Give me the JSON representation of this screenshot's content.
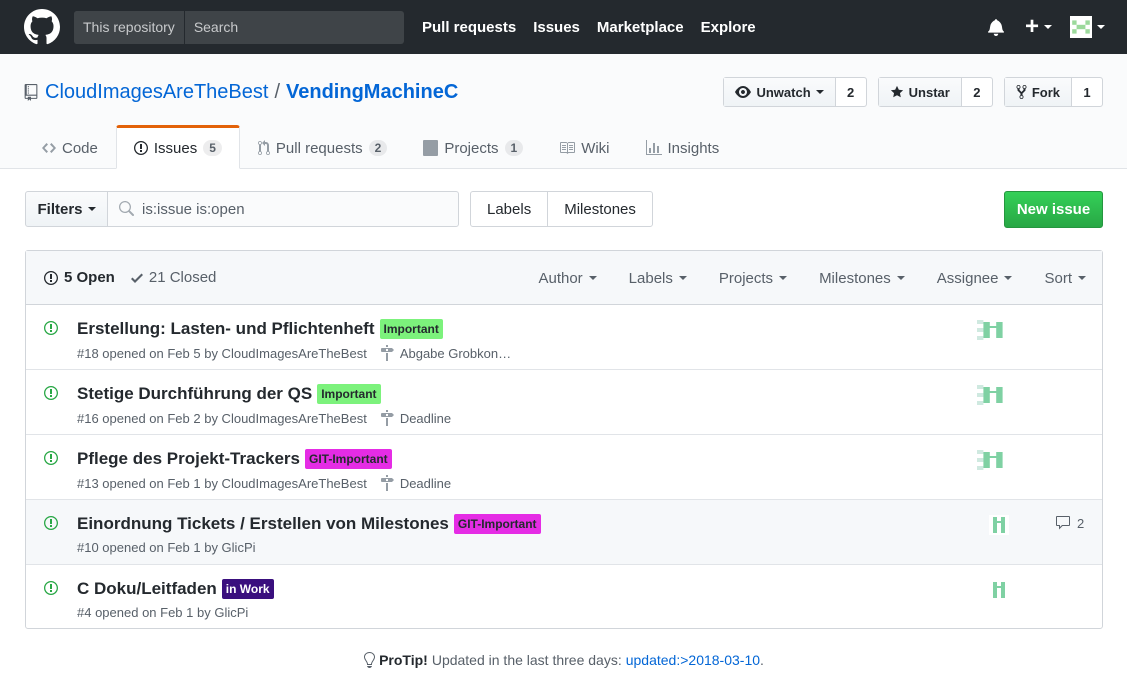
{
  "header": {
    "search_scope": "This repository",
    "search_placeholder": "Search",
    "nav": [
      "Pull requests",
      "Issues",
      "Marketplace",
      "Explore"
    ]
  },
  "repo": {
    "owner": "CloudImagesAreTheBest",
    "separator": "/",
    "name": "VendingMachineC",
    "unwatch_label": "Unwatch",
    "watch_count": "2",
    "unstar_label": "Unstar",
    "star_count": "2",
    "fork_label": "Fork",
    "fork_count": "1"
  },
  "tabs": [
    {
      "label": "Code",
      "count": ""
    },
    {
      "label": "Issues",
      "count": "5"
    },
    {
      "label": "Pull requests",
      "count": "2"
    },
    {
      "label": "Projects",
      "count": "1"
    },
    {
      "label": "Wiki",
      "count": ""
    },
    {
      "label": "Insights",
      "count": ""
    }
  ],
  "filterbar": {
    "filters_label": "Filters",
    "query": "is:issue is:open",
    "labels_label": "Labels",
    "milestones_label": "Milestones",
    "new_issue_label": "New issue"
  },
  "issues_header": {
    "open_label": "5 Open",
    "closed_label": "21 Closed",
    "menus": [
      "Author",
      "Labels",
      "Projects",
      "Milestones",
      "Assignee",
      "Sort"
    ]
  },
  "issues": [
    {
      "title": "Erstellung: Lasten- und Pflichtenheft",
      "label": "Important",
      "label_bg": "#7cf27c",
      "label_fg": "#24292e",
      "meta": "#18 opened on Feb 5 by CloudImagesAreTheBest",
      "milestone": "Abgabe Grobkon…",
      "comments": ""
    },
    {
      "title": "Stetige Durchführung der QS",
      "label": "Important",
      "label_bg": "#7cf27c",
      "label_fg": "#24292e",
      "meta": "#16 opened on Feb 2 by CloudImagesAreTheBest",
      "milestone": "Deadline",
      "comments": ""
    },
    {
      "title": "Pflege des Projekt-Trackers",
      "label": "GIT-Important",
      "label_bg": "#e52ce5",
      "label_fg": "#24292e",
      "meta": "#13 opened on Feb 1 by CloudImagesAreTheBest",
      "milestone": "Deadline",
      "comments": ""
    },
    {
      "title": "Einordnung Tickets / Erstellen von Milestones",
      "label": "GIT-Important",
      "label_bg": "#e52ce5",
      "label_fg": "#24292e",
      "meta": "#10 opened on Feb 1 by GlicPi",
      "milestone": "",
      "comments": "2"
    },
    {
      "title": "C Doku/Leitfaden",
      "label": "in Work",
      "label_bg": "#3a0f7e",
      "label_fg": "#ffffff",
      "meta": "#4 opened on Feb 1 by GlicPi",
      "milestone": "",
      "comments": ""
    }
  ],
  "protip": {
    "prefix": "ProTip!",
    "text": "Updated in the last three days:",
    "link": "updated:>2018-03-10",
    "suffix": "."
  },
  "colors": {
    "header_bg": "#24292e",
    "link": "#0366d6",
    "open_green": "#28a745",
    "tab_accent": "#e36209"
  }
}
